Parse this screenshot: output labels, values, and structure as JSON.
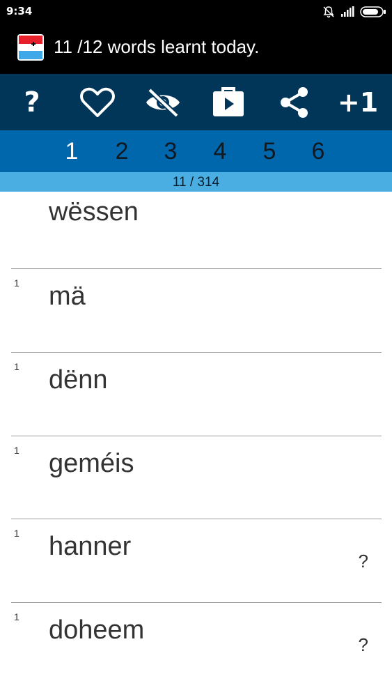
{
  "status_bar": {
    "time": "9:34",
    "icons": [
      "mute-icon",
      "signal-icon",
      "battery-icon"
    ]
  },
  "header": {
    "title": "11 /12 words learnt today.",
    "flag_icon": "luxembourg-flag-icon"
  },
  "toolbar": {
    "help_label": "?",
    "plus_one_label": "+1",
    "icons": [
      "help-icon",
      "heart-icon",
      "hide-eye-icon",
      "play-store-icon",
      "share-icon",
      "plus-one-icon"
    ]
  },
  "levels": [
    {
      "label": "1",
      "active": true
    },
    {
      "label": "2",
      "active": false
    },
    {
      "label": "3",
      "active": false
    },
    {
      "label": "4",
      "active": false
    },
    {
      "label": "5",
      "active": false
    },
    {
      "label": "6",
      "active": false
    }
  ],
  "progress": {
    "text": "11 / 314"
  },
  "words": [
    {
      "level": "",
      "word": "wëssen",
      "hint": ""
    },
    {
      "level": "1",
      "word": "mä",
      "hint": ""
    },
    {
      "level": "1",
      "word": "dënn",
      "hint": ""
    },
    {
      "level": "1",
      "word": "geméis",
      "hint": ""
    },
    {
      "level": "1",
      "word": "hanner",
      "hint": "?"
    },
    {
      "level": "1",
      "word": "doheem",
      "hint": "?"
    }
  ],
  "colors": {
    "toolbar_bg": "#013659",
    "level_bar_bg": "#0067ad",
    "progress_bg": "#4aaee3",
    "header_bg": "#000000"
  }
}
